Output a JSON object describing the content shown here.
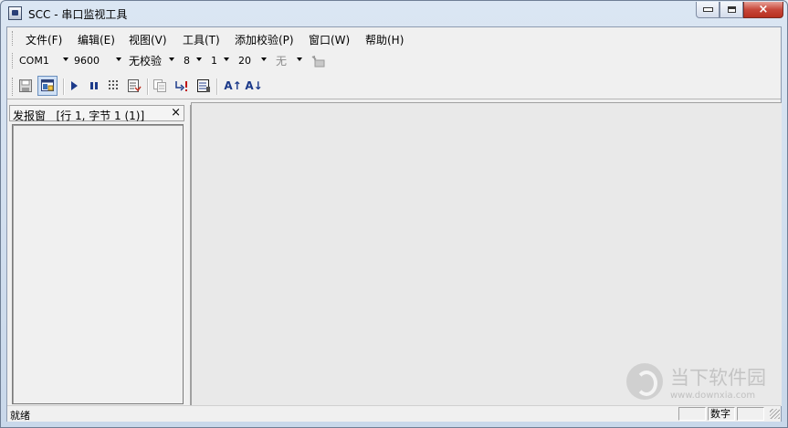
{
  "window": {
    "title": "SCC - 串口监视工具",
    "close_glyph": "×"
  },
  "menu": [
    {
      "label": "文件(F)"
    },
    {
      "label": "编辑(E)"
    },
    {
      "label": "视图(V)"
    },
    {
      "label": "工具(T)"
    },
    {
      "label": "添加校验(P)"
    },
    {
      "label": "窗口(W)"
    },
    {
      "label": "帮助(H)"
    }
  ],
  "serial_settings": {
    "port": "COM1",
    "baud": "9600",
    "parity": "无校验",
    "data_bits": "8",
    "stop_bits": "1",
    "timeout": "20",
    "flow": "无"
  },
  "toolbar": {
    "font_increase_label": "A↑",
    "font_decrease_label": "A↓",
    "icons": [
      "save-icon",
      "send-window-icon",
      "play-icon",
      "pause-icon",
      "grid-icon",
      "log-icon",
      "copy-icon",
      "send-now-icon",
      "clear-icon",
      "font-increase-icon",
      "font-decrease-icon"
    ]
  },
  "send_panel": {
    "title": "发报窗",
    "position": "[行 1, 字节 1 (1)]",
    "close_glyph": "×"
  },
  "watermark": {
    "text": "当下软件园",
    "url": "www.downxia.com"
  },
  "status": {
    "message": "就绪",
    "num_indicator": "数字"
  }
}
